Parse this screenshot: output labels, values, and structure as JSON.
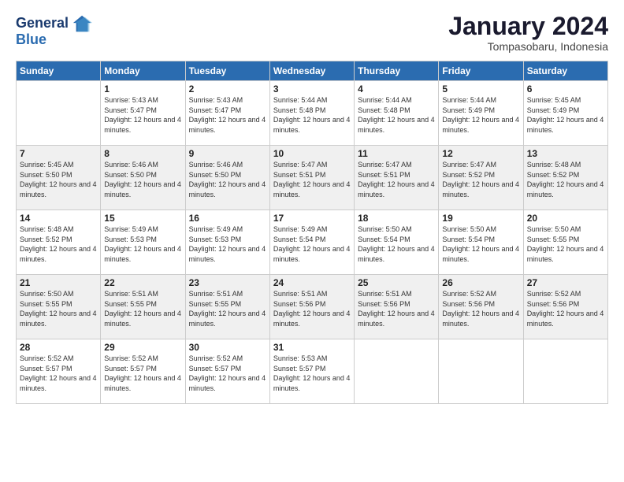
{
  "header": {
    "logo_line1": "General",
    "logo_line2": "Blue",
    "month": "January 2024",
    "location": "Tompasobaru, Indonesia"
  },
  "days_of_week": [
    "Sunday",
    "Monday",
    "Tuesday",
    "Wednesday",
    "Thursday",
    "Friday",
    "Saturday"
  ],
  "weeks": [
    [
      {
        "day": "",
        "info": ""
      },
      {
        "day": "1",
        "info": "Sunrise: 5:43 AM\nSunset: 5:47 PM\nDaylight: 12 hours and 4 minutes."
      },
      {
        "day": "2",
        "info": "Sunrise: 5:43 AM\nSunset: 5:47 PM\nDaylight: 12 hours and 4 minutes."
      },
      {
        "day": "3",
        "info": "Sunrise: 5:44 AM\nSunset: 5:48 PM\nDaylight: 12 hours and 4 minutes."
      },
      {
        "day": "4",
        "info": "Sunrise: 5:44 AM\nSunset: 5:48 PM\nDaylight: 12 hours and 4 minutes."
      },
      {
        "day": "5",
        "info": "Sunrise: 5:44 AM\nSunset: 5:49 PM\nDaylight: 12 hours and 4 minutes."
      },
      {
        "day": "6",
        "info": "Sunrise: 5:45 AM\nSunset: 5:49 PM\nDaylight: 12 hours and 4 minutes."
      }
    ],
    [
      {
        "day": "7",
        "info": "Sunrise: 5:45 AM\nSunset: 5:50 PM\nDaylight: 12 hours and 4 minutes."
      },
      {
        "day": "8",
        "info": "Sunrise: 5:46 AM\nSunset: 5:50 PM\nDaylight: 12 hours and 4 minutes."
      },
      {
        "day": "9",
        "info": "Sunrise: 5:46 AM\nSunset: 5:50 PM\nDaylight: 12 hours and 4 minutes."
      },
      {
        "day": "10",
        "info": "Sunrise: 5:47 AM\nSunset: 5:51 PM\nDaylight: 12 hours and 4 minutes."
      },
      {
        "day": "11",
        "info": "Sunrise: 5:47 AM\nSunset: 5:51 PM\nDaylight: 12 hours and 4 minutes."
      },
      {
        "day": "12",
        "info": "Sunrise: 5:47 AM\nSunset: 5:52 PM\nDaylight: 12 hours and 4 minutes."
      },
      {
        "day": "13",
        "info": "Sunrise: 5:48 AM\nSunset: 5:52 PM\nDaylight: 12 hours and 4 minutes."
      }
    ],
    [
      {
        "day": "14",
        "info": "Sunrise: 5:48 AM\nSunset: 5:52 PM\nDaylight: 12 hours and 4 minutes."
      },
      {
        "day": "15",
        "info": "Sunrise: 5:49 AM\nSunset: 5:53 PM\nDaylight: 12 hours and 4 minutes."
      },
      {
        "day": "16",
        "info": "Sunrise: 5:49 AM\nSunset: 5:53 PM\nDaylight: 12 hours and 4 minutes."
      },
      {
        "day": "17",
        "info": "Sunrise: 5:49 AM\nSunset: 5:54 PM\nDaylight: 12 hours and 4 minutes."
      },
      {
        "day": "18",
        "info": "Sunrise: 5:50 AM\nSunset: 5:54 PM\nDaylight: 12 hours and 4 minutes."
      },
      {
        "day": "19",
        "info": "Sunrise: 5:50 AM\nSunset: 5:54 PM\nDaylight: 12 hours and 4 minutes."
      },
      {
        "day": "20",
        "info": "Sunrise: 5:50 AM\nSunset: 5:55 PM\nDaylight: 12 hours and 4 minutes."
      }
    ],
    [
      {
        "day": "21",
        "info": "Sunrise: 5:50 AM\nSunset: 5:55 PM\nDaylight: 12 hours and 4 minutes."
      },
      {
        "day": "22",
        "info": "Sunrise: 5:51 AM\nSunset: 5:55 PM\nDaylight: 12 hours and 4 minutes."
      },
      {
        "day": "23",
        "info": "Sunrise: 5:51 AM\nSunset: 5:55 PM\nDaylight: 12 hours and 4 minutes."
      },
      {
        "day": "24",
        "info": "Sunrise: 5:51 AM\nSunset: 5:56 PM\nDaylight: 12 hours and 4 minutes."
      },
      {
        "day": "25",
        "info": "Sunrise: 5:51 AM\nSunset: 5:56 PM\nDaylight: 12 hours and 4 minutes."
      },
      {
        "day": "26",
        "info": "Sunrise: 5:52 AM\nSunset: 5:56 PM\nDaylight: 12 hours and 4 minutes."
      },
      {
        "day": "27",
        "info": "Sunrise: 5:52 AM\nSunset: 5:56 PM\nDaylight: 12 hours and 4 minutes."
      }
    ],
    [
      {
        "day": "28",
        "info": "Sunrise: 5:52 AM\nSunset: 5:57 PM\nDaylight: 12 hours and 4 minutes."
      },
      {
        "day": "29",
        "info": "Sunrise: 5:52 AM\nSunset: 5:57 PM\nDaylight: 12 hours and 4 minutes."
      },
      {
        "day": "30",
        "info": "Sunrise: 5:52 AM\nSunset: 5:57 PM\nDaylight: 12 hours and 4 minutes."
      },
      {
        "day": "31",
        "info": "Sunrise: 5:53 AM\nSunset: 5:57 PM\nDaylight: 12 hours and 4 minutes."
      },
      {
        "day": "",
        "info": ""
      },
      {
        "day": "",
        "info": ""
      },
      {
        "day": "",
        "info": ""
      }
    ]
  ]
}
